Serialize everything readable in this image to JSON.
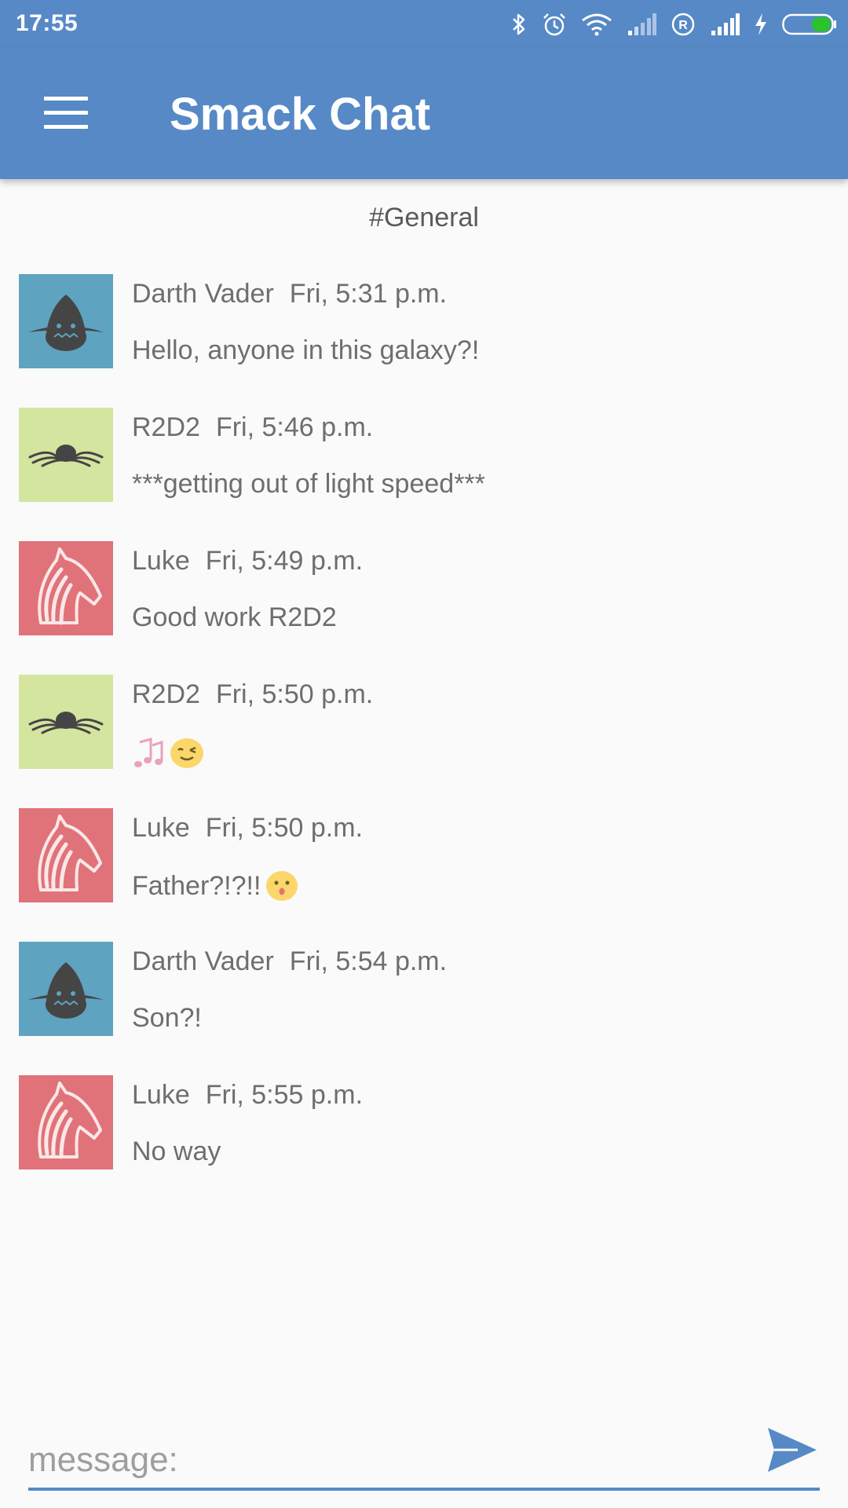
{
  "status_bar": {
    "time": "17:55",
    "icons": [
      "bluetooth-icon",
      "alarm-icon",
      "wifi-icon",
      "signal-icon",
      "roaming-icon",
      "signal-icon",
      "charging-icon",
      "battery-icon"
    ]
  },
  "app_bar": {
    "title": "Smack Chat",
    "menu_icon": "hamburger-menu-icon",
    "color": "#5689c6"
  },
  "channel": {
    "name": "#General"
  },
  "messages": [
    {
      "user": "Darth Vader",
      "time": "Fri, 5:31 p.m.",
      "text": "Hello, anyone in this galaxy?!",
      "avatar": "shark-avatar",
      "avatar_color": "#5ea3c0"
    },
    {
      "user": "R2D2",
      "time": "Fri, 5:46 p.m.",
      "text": "***getting out of light speed***",
      "avatar": "octopus-avatar",
      "avatar_color": "#d4e59f"
    },
    {
      "user": "Luke",
      "time": "Fri, 5:49 p.m.",
      "text": "Good work R2D2",
      "avatar": "horse-avatar",
      "avatar_color": "#e07379"
    },
    {
      "user": "R2D2",
      "time": "Fri, 5:50 p.m.",
      "text": "",
      "emojis": [
        "music-notes-emoji",
        "winking-face-emoji"
      ],
      "avatar": "octopus-avatar",
      "avatar_color": "#d4e59f"
    },
    {
      "user": "Luke",
      "time": "Fri, 5:50 p.m.",
      "text": "Father?!?!!",
      "emojis": [
        "surprised-face-emoji"
      ],
      "avatar": "horse-avatar",
      "avatar_color": "#e07379"
    },
    {
      "user": "Darth Vader",
      "time": "Fri, 5:54 p.m.",
      "text": "Son?!",
      "avatar": "shark-avatar",
      "avatar_color": "#5ea3c0"
    },
    {
      "user": "Luke",
      "time": "Fri, 5:55 p.m.",
      "text": "No way",
      "avatar": "horse-avatar",
      "avatar_color": "#e07379"
    }
  ],
  "composer": {
    "placeholder": "message:",
    "value": "",
    "send_icon": "send-icon"
  }
}
